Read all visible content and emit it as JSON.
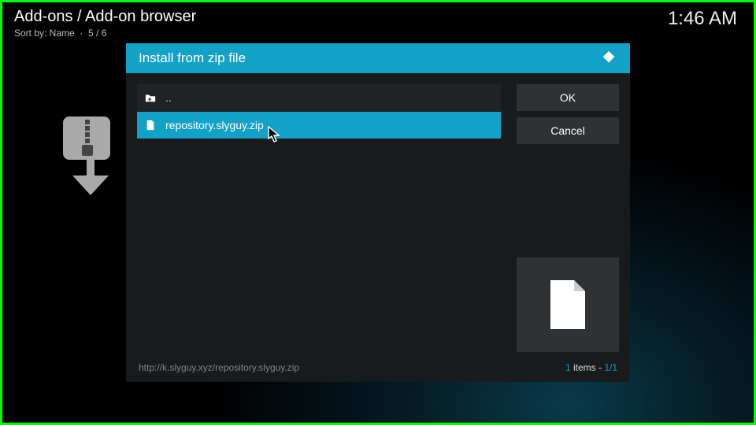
{
  "header": {
    "title": "Add-ons / Add-on browser",
    "sort_label": "Sort by: Name",
    "position": "5 / 6"
  },
  "clock": "1:46 AM",
  "dialog": {
    "title": "Install from zip file",
    "ok_label": "OK",
    "cancel_label": "Cancel",
    "parent_label": "..",
    "files": [
      {
        "name": "repository.slyguy.zip",
        "selected": true
      }
    ]
  },
  "footer": {
    "path": "http://k.slyguy.xyz/repository.slyguy.zip",
    "items_word": "items",
    "count_current": "1",
    "count_sep": " - ",
    "count_page": "1/1"
  }
}
